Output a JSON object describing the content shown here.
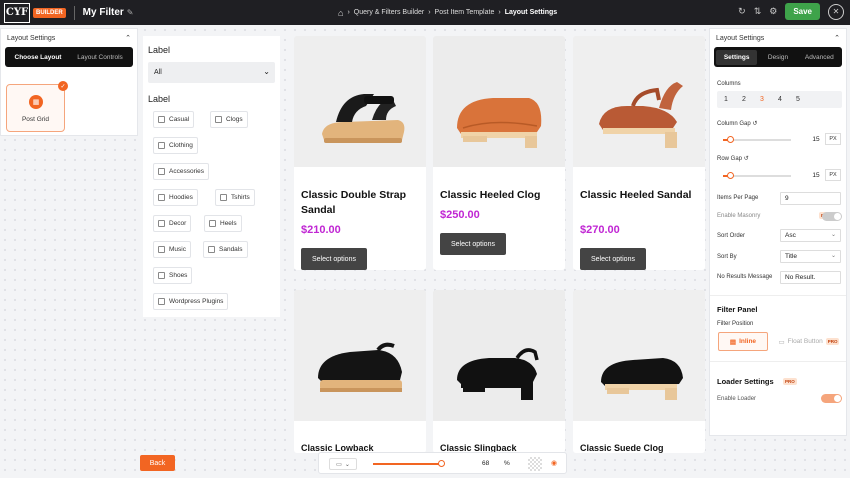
{
  "app": {
    "logo": "CYF",
    "builder_badge": "BUILDER",
    "filter_name": "My Filter"
  },
  "breadcrumb": [
    "Query & Filters Builder",
    "Post Item Template",
    "Layout Settings"
  ],
  "toolbar": {
    "save_label": "Save"
  },
  "left_panel": {
    "title": "Layout Settings",
    "tabs": [
      "Choose Layout",
      "Layout Controls"
    ],
    "layout_option": "Post Grid"
  },
  "filter_panel": {
    "select_label": "Label",
    "select_value": "All",
    "checkbox_label": "Label",
    "options": [
      "Casual",
      "Clogs",
      "Clothing",
      "Accessories",
      "Hoodies",
      "Tshirts",
      "Decor",
      "Heels",
      "Music",
      "Sandals",
      "Shoes",
      "Wordpress Plugins"
    ]
  },
  "products": [
    {
      "title": "Classic Double Strap Sandal",
      "price": "$210.00",
      "button": "Select options"
    },
    {
      "title": "Classic Heeled Clog",
      "price": "$250.00",
      "button": "Select options"
    },
    {
      "title": "Classic Heeled Sandal",
      "price": "$270.00",
      "button": "Select options"
    },
    {
      "title": "Classic Lowback",
      "price": "",
      "button": ""
    },
    {
      "title": "Classic Slingback",
      "price": "",
      "button": ""
    },
    {
      "title": "Classic Suede Clog",
      "price": "",
      "button": ""
    }
  ],
  "right_panel": {
    "title": "Layout Settings",
    "tabs": [
      "Settings",
      "Design",
      "Advanced"
    ],
    "columns_label": "Columns",
    "columns": [
      "1",
      "2",
      "3",
      "4",
      "5"
    ],
    "columns_selected": "3",
    "column_gap_label": "Column Gap",
    "column_gap": "15",
    "row_gap_label": "Row Gap",
    "row_gap": "15",
    "unit": "PX",
    "items_per_page_label": "Items Per Page",
    "items_per_page": "9",
    "enable_masonry_label": "Enable Masonry",
    "pro_badge": "PRO",
    "sort_order_label": "Sort Order",
    "sort_order": "Asc",
    "sort_by_label": "Sort By",
    "sort_by": "Title",
    "no_results_label": "No Results Message",
    "no_results_value": "No Result.",
    "filter_panel_heading": "Filter Panel",
    "filter_position_label": "Filter Position",
    "position_options": [
      "Inline",
      "Float Button"
    ],
    "loader_heading": "Loader Settings",
    "enable_loader_label": "Enable Loader"
  },
  "bottom": {
    "back_label": "Back",
    "zoom": "68",
    "zoom_unit": "%"
  },
  "colors": {
    "accent": "#f26522",
    "price": "#c026d3",
    "save": "#3ea34a"
  }
}
